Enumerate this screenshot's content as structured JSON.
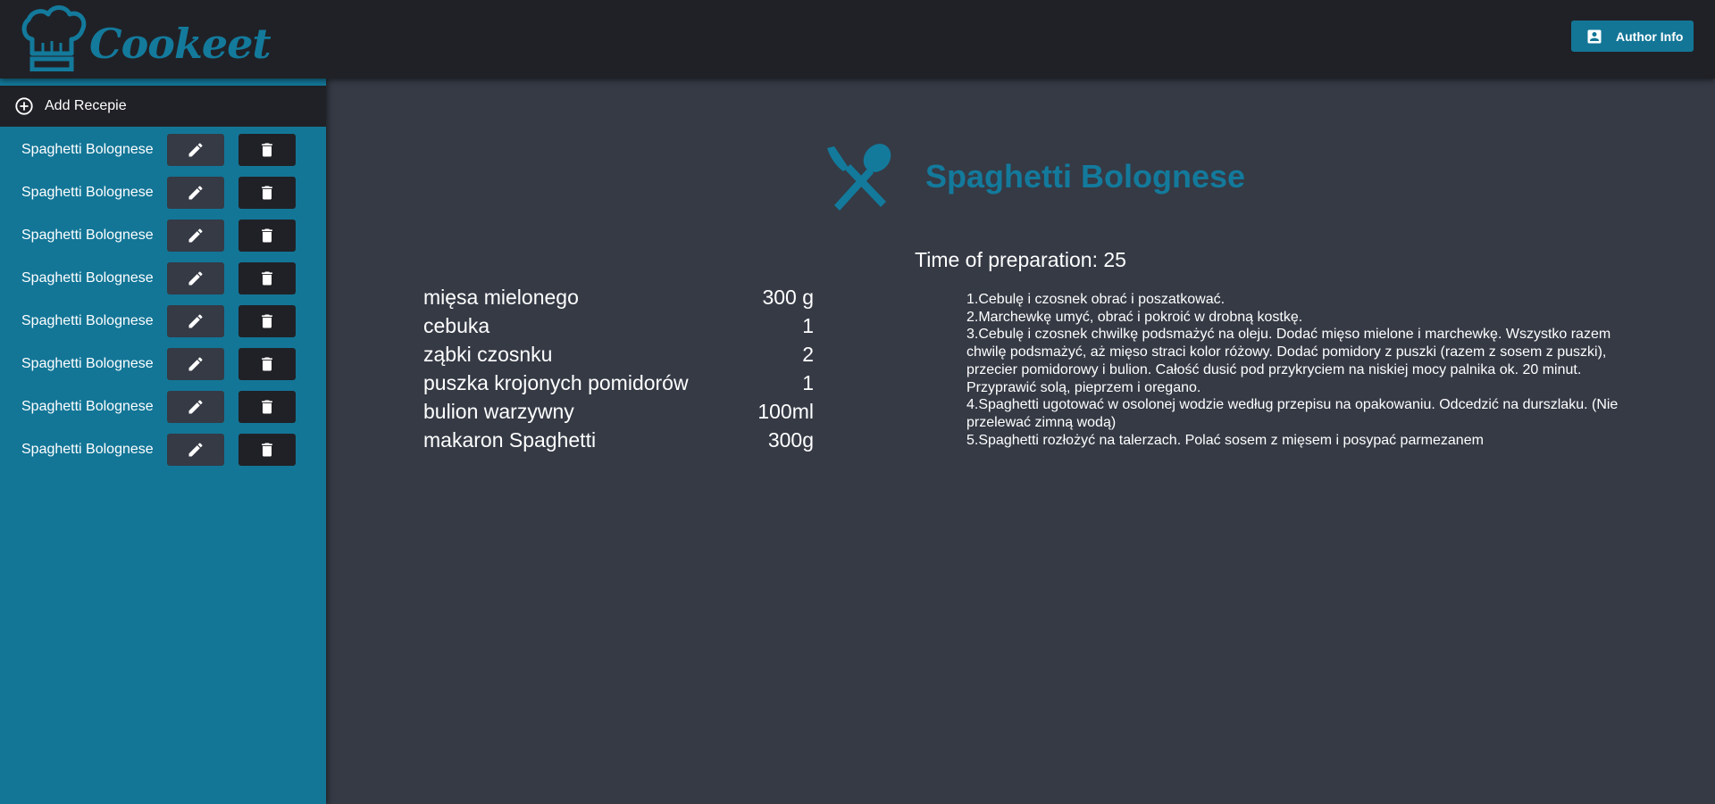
{
  "header": {
    "logo_text": "Cookeet",
    "author_button_label": "Author Info"
  },
  "sidebar": {
    "add_label": "Add Recepie",
    "recipes": [
      {
        "name": "Spaghetti Bolognese"
      },
      {
        "name": "Spaghetti Bolognese"
      },
      {
        "name": "Spaghetti Bolognese"
      },
      {
        "name": "Spaghetti Bolognese"
      },
      {
        "name": "Spaghetti Bolognese"
      },
      {
        "name": "Spaghetti Bolognese"
      },
      {
        "name": "Spaghetti Bolognese"
      },
      {
        "name": "Spaghetti Bolognese"
      }
    ]
  },
  "recipe": {
    "title": "Spaghetti Bolognese",
    "prep_label": "Time of preparation: ",
    "prep_value": "25",
    "ingredients": [
      {
        "name": "mięsa mielonego",
        "amount": "300 g"
      },
      {
        "name": "cebuka",
        "amount": "1"
      },
      {
        "name": "ząbki czosnku",
        "amount": "2"
      },
      {
        "name": "puszka krojonych pomidorów",
        "amount": "1"
      },
      {
        "name": "bulion warzywny",
        "amount": "100ml"
      },
      {
        "name": "makaron Spaghetti",
        "amount": "300g"
      }
    ],
    "steps": [
      "1.Cebulę i czosnek obrać i poszatkować.",
      "2.Marchewkę umyć, obrać i pokroić w drobną kostkę.",
      "3.Cebulę i czosnek chwilkę podsmażyć na oleju. Dodać mięso mielone i marchewkę. Wszystko razem chwilę podsmażyć, aż mięso straci kolor różowy. Dodać pomidory z puszki (razem z sosem z puszki), przecier pomidorowy i bulion. Całość dusić pod przykryciem na niskiej mocy palnika ok. 20 minut. Przyprawić solą, pieprzem i oregano.",
      "4.Spaghetti ugotować w osolonej wodzie według przepisu na opakowaniu. Odcedzić na durszlaku. (Nie przelewać zimną wodą)",
      "5.Spaghetti rozłożyć na talerzach. Polać sosem z mięsem i posypać parmezanem"
    ]
  },
  "icons": {
    "logo": "chef-hat-icon",
    "author": "account-box-icon",
    "add": "add-circle-icon",
    "edit": "pencil-icon",
    "delete": "trash-icon",
    "title": "fork-spoon-icon"
  },
  "colors": {
    "header_bg": "#202126",
    "sidebar_bg": "#137697",
    "main_bg": "#353a45",
    "accent": "#137a9c",
    "edit_btn_bg": "#353a45",
    "delete_btn_bg": "#202126"
  }
}
